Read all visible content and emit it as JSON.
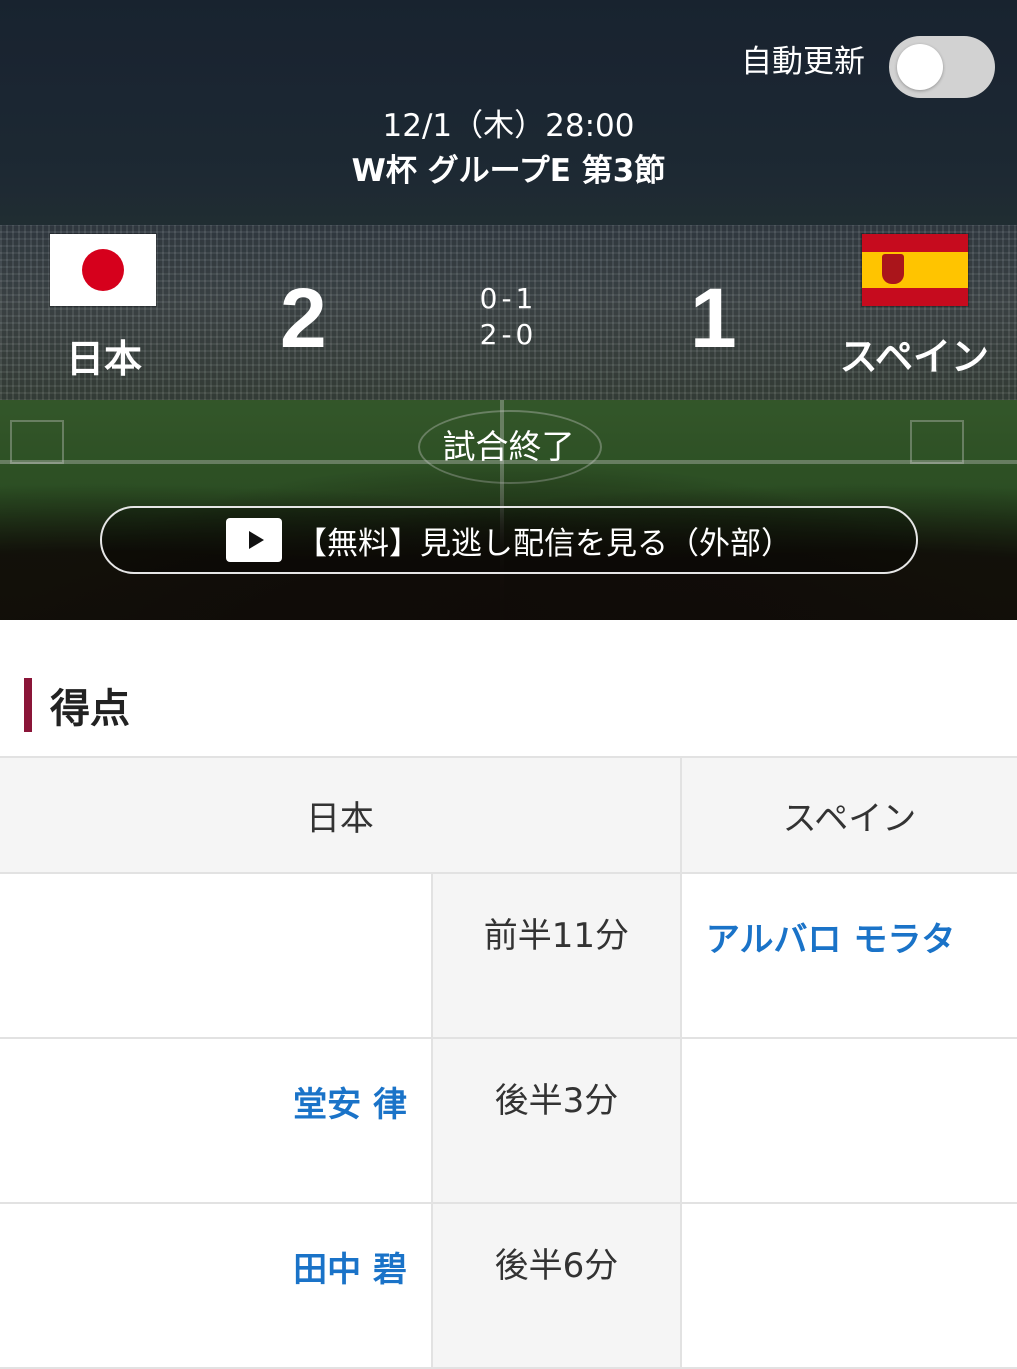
{
  "header": {
    "auto_update_label": "自動更新",
    "auto_update_on": false,
    "date": "12/1（木）28:00",
    "round": "W杯 グループE 第3節"
  },
  "match": {
    "home": {
      "name": "日本",
      "score": "2",
      "flag": "japan-flag"
    },
    "away": {
      "name": "スペイン",
      "score": "1",
      "flag": "spain-flag"
    },
    "half_scores": [
      "0-1",
      "2-0"
    ],
    "status": "試合終了",
    "watch_label": "【無料】見逃し配信を見る（外部）"
  },
  "goals": {
    "title": "得点",
    "columns": [
      "日本",
      "スペイン"
    ],
    "rows": [
      {
        "home": "",
        "time": "前半11分",
        "away": "アルバロ モラタ"
      },
      {
        "home": "堂安 律",
        "time": "後半3分",
        "away": ""
      },
      {
        "home": "田中 碧",
        "time": "後半6分",
        "away": ""
      }
    ]
  },
  "colors": {
    "accent_bar": "#8a1538",
    "player_link": "#1a73c8",
    "toggle_off": "#d2d2d2"
  }
}
